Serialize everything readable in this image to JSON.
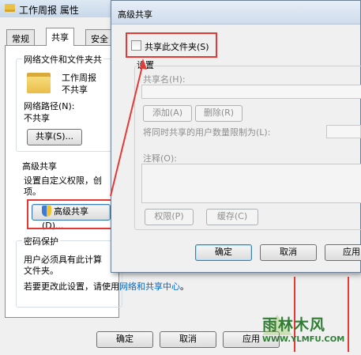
{
  "props_window": {
    "title": "工作周报 属性",
    "tabs": [
      "常规",
      "共享",
      "安全"
    ],
    "network_section_title": "网络文件和文件夹共",
    "folder_name": "工作周报",
    "folder_share_state": "不共享",
    "network_path_label": "网络路径(N):",
    "network_path_value": "不共享",
    "share_button": "共享(S)...",
    "advanced_section_title": "高级共享",
    "advanced_desc_line1": "设置自定义权限，创",
    "advanced_desc_line2": "项。",
    "advanced_share_button": "高级共享(D)...",
    "password_section_title": "密码保护",
    "password_desc_line1": "用户必须具有此计算",
    "password_desc_line2": "文件夹。",
    "change_setting_text": "若要更改此设置，请使用",
    "network_center_link": "网络和共享中心",
    "change_setting_suffix": "。",
    "ok_button": "确定",
    "cancel_button": "取消",
    "apply_button": "应用"
  },
  "adv_window": {
    "title": "高级共享",
    "share_checkbox_label": "共享此文件夹(S)",
    "share_checked": false,
    "settings_label": "设置",
    "share_name_label": "共享名(H):",
    "add_button": "添加(A)",
    "remove_button": "删除(R)",
    "user_limit_label": "将同时共享的用户数量限制为(L):",
    "comment_label": "注释(O):",
    "permissions_button": "权限(P)",
    "cache_button": "缓存(C)",
    "ok_button": "确定",
    "cancel_button": "取消",
    "apply_button": "应用"
  },
  "watermark": {
    "name": "雨林木风",
    "url": "WWW.YLMFU.COM"
  },
  "colors": {
    "highlight_red": "#e53935",
    "link_blue": "#0066cc",
    "watermark_green": "#2e7d32"
  }
}
